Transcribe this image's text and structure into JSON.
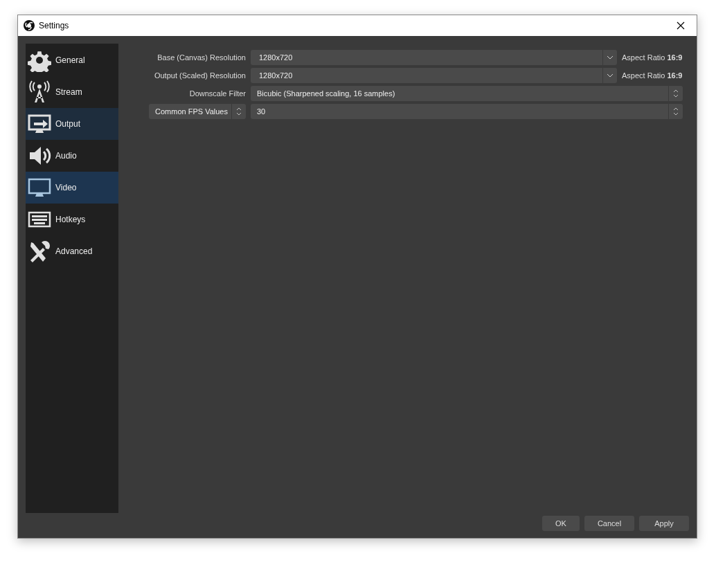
{
  "window": {
    "title": "Settings"
  },
  "sidebar": {
    "items": [
      {
        "label": "General",
        "kind": "gear",
        "selected": false,
        "hovered": false
      },
      {
        "label": "Stream",
        "kind": "antenna",
        "selected": false,
        "hovered": false
      },
      {
        "label": "Output",
        "kind": "output",
        "selected": false,
        "hovered": true
      },
      {
        "label": "Audio",
        "kind": "speaker",
        "selected": false,
        "hovered": false
      },
      {
        "label": "Video",
        "kind": "monitor",
        "selected": true,
        "hovered": false
      },
      {
        "label": "Hotkeys",
        "kind": "keyboard",
        "selected": false,
        "hovered": false
      },
      {
        "label": "Advanced",
        "kind": "tools",
        "selected": false,
        "hovered": false
      }
    ]
  },
  "form": {
    "rows": [
      {
        "kind": "editable-combo",
        "label": "Base (Canvas) Resolution",
        "value": "1280x720",
        "note": "Aspect Ratio **16:9**"
      },
      {
        "kind": "editable-combo",
        "label": "Output (Scaled) Resolution",
        "value": "1280x720",
        "note": "Aspect Ratio **16:9**"
      },
      {
        "kind": "combo",
        "label": "Downscale Filter",
        "value": "Bicubic (Sharpened scaling, 16 samples)"
      },
      {
        "kind": "label-combo",
        "label": "Common FPS Values",
        "value": "30"
      }
    ]
  },
  "buttons": [
    "OK",
    "Cancel",
    "Apply"
  ]
}
